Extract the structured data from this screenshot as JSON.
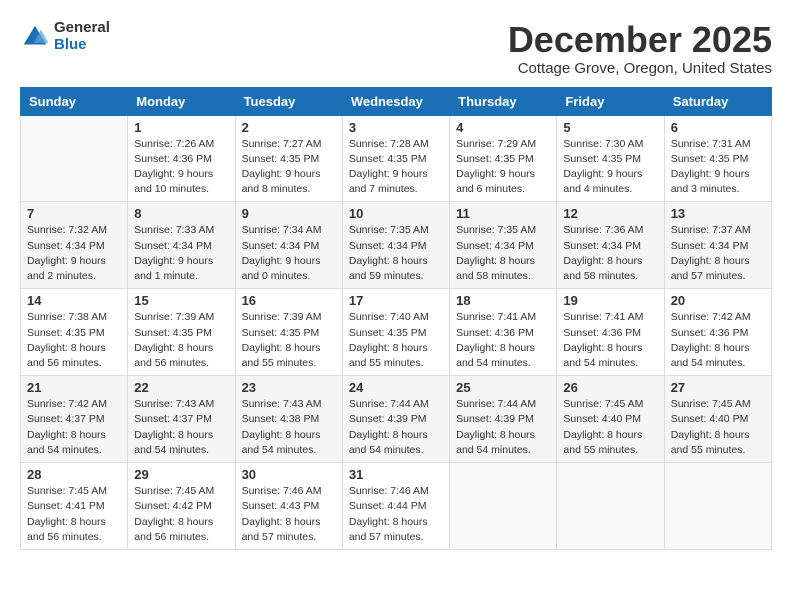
{
  "logo": {
    "general": "General",
    "blue": "Blue"
  },
  "title": "December 2025",
  "subtitle": "Cottage Grove, Oregon, United States",
  "days_header": [
    "Sunday",
    "Monday",
    "Tuesday",
    "Wednesday",
    "Thursday",
    "Friday",
    "Saturday"
  ],
  "weeks": [
    [
      {
        "num": "",
        "info": ""
      },
      {
        "num": "1",
        "info": "Sunrise: 7:26 AM\nSunset: 4:36 PM\nDaylight: 9 hours\nand 10 minutes."
      },
      {
        "num": "2",
        "info": "Sunrise: 7:27 AM\nSunset: 4:35 PM\nDaylight: 9 hours\nand 8 minutes."
      },
      {
        "num": "3",
        "info": "Sunrise: 7:28 AM\nSunset: 4:35 PM\nDaylight: 9 hours\nand 7 minutes."
      },
      {
        "num": "4",
        "info": "Sunrise: 7:29 AM\nSunset: 4:35 PM\nDaylight: 9 hours\nand 6 minutes."
      },
      {
        "num": "5",
        "info": "Sunrise: 7:30 AM\nSunset: 4:35 PM\nDaylight: 9 hours\nand 4 minutes."
      },
      {
        "num": "6",
        "info": "Sunrise: 7:31 AM\nSunset: 4:35 PM\nDaylight: 9 hours\nand 3 minutes."
      }
    ],
    [
      {
        "num": "7",
        "info": "Sunrise: 7:32 AM\nSunset: 4:34 PM\nDaylight: 9 hours\nand 2 minutes."
      },
      {
        "num": "8",
        "info": "Sunrise: 7:33 AM\nSunset: 4:34 PM\nDaylight: 9 hours\nand 1 minute."
      },
      {
        "num": "9",
        "info": "Sunrise: 7:34 AM\nSunset: 4:34 PM\nDaylight: 9 hours\nand 0 minutes."
      },
      {
        "num": "10",
        "info": "Sunrise: 7:35 AM\nSunset: 4:34 PM\nDaylight: 8 hours\nand 59 minutes."
      },
      {
        "num": "11",
        "info": "Sunrise: 7:35 AM\nSunset: 4:34 PM\nDaylight: 8 hours\nand 58 minutes."
      },
      {
        "num": "12",
        "info": "Sunrise: 7:36 AM\nSunset: 4:34 PM\nDaylight: 8 hours\nand 58 minutes."
      },
      {
        "num": "13",
        "info": "Sunrise: 7:37 AM\nSunset: 4:34 PM\nDaylight: 8 hours\nand 57 minutes."
      }
    ],
    [
      {
        "num": "14",
        "info": "Sunrise: 7:38 AM\nSunset: 4:35 PM\nDaylight: 8 hours\nand 56 minutes."
      },
      {
        "num": "15",
        "info": "Sunrise: 7:39 AM\nSunset: 4:35 PM\nDaylight: 8 hours\nand 56 minutes."
      },
      {
        "num": "16",
        "info": "Sunrise: 7:39 AM\nSunset: 4:35 PM\nDaylight: 8 hours\nand 55 minutes."
      },
      {
        "num": "17",
        "info": "Sunrise: 7:40 AM\nSunset: 4:35 PM\nDaylight: 8 hours\nand 55 minutes."
      },
      {
        "num": "18",
        "info": "Sunrise: 7:41 AM\nSunset: 4:36 PM\nDaylight: 8 hours\nand 54 minutes."
      },
      {
        "num": "19",
        "info": "Sunrise: 7:41 AM\nSunset: 4:36 PM\nDaylight: 8 hours\nand 54 minutes."
      },
      {
        "num": "20",
        "info": "Sunrise: 7:42 AM\nSunset: 4:36 PM\nDaylight: 8 hours\nand 54 minutes."
      }
    ],
    [
      {
        "num": "21",
        "info": "Sunrise: 7:42 AM\nSunset: 4:37 PM\nDaylight: 8 hours\nand 54 minutes."
      },
      {
        "num": "22",
        "info": "Sunrise: 7:43 AM\nSunset: 4:37 PM\nDaylight: 8 hours\nand 54 minutes."
      },
      {
        "num": "23",
        "info": "Sunrise: 7:43 AM\nSunset: 4:38 PM\nDaylight: 8 hours\nand 54 minutes."
      },
      {
        "num": "24",
        "info": "Sunrise: 7:44 AM\nSunset: 4:39 PM\nDaylight: 8 hours\nand 54 minutes."
      },
      {
        "num": "25",
        "info": "Sunrise: 7:44 AM\nSunset: 4:39 PM\nDaylight: 8 hours\nand 54 minutes."
      },
      {
        "num": "26",
        "info": "Sunrise: 7:45 AM\nSunset: 4:40 PM\nDaylight: 8 hours\nand 55 minutes."
      },
      {
        "num": "27",
        "info": "Sunrise: 7:45 AM\nSunset: 4:40 PM\nDaylight: 8 hours\nand 55 minutes."
      }
    ],
    [
      {
        "num": "28",
        "info": "Sunrise: 7:45 AM\nSunset: 4:41 PM\nDaylight: 8 hours\nand 56 minutes."
      },
      {
        "num": "29",
        "info": "Sunrise: 7:45 AM\nSunset: 4:42 PM\nDaylight: 8 hours\nand 56 minutes."
      },
      {
        "num": "30",
        "info": "Sunrise: 7:46 AM\nSunset: 4:43 PM\nDaylight: 8 hours\nand 57 minutes."
      },
      {
        "num": "31",
        "info": "Sunrise: 7:46 AM\nSunset: 4:44 PM\nDaylight: 8 hours\nand 57 minutes."
      },
      {
        "num": "",
        "info": ""
      },
      {
        "num": "",
        "info": ""
      },
      {
        "num": "",
        "info": ""
      }
    ]
  ]
}
